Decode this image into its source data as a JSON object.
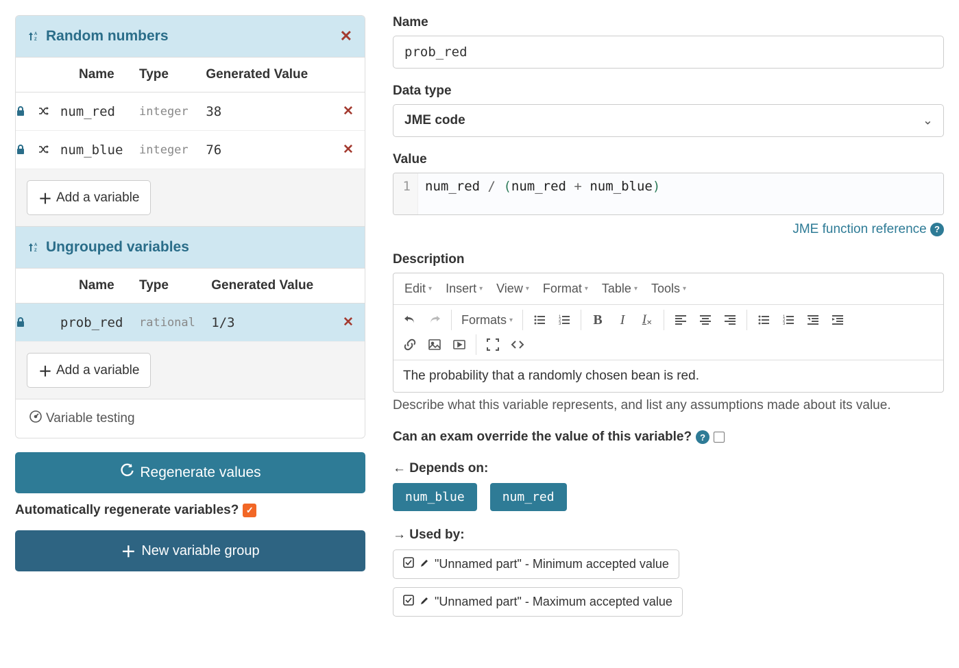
{
  "left": {
    "groups": [
      {
        "title": "Random numbers",
        "can_delete": true,
        "columns": {
          "name": "Name",
          "type": "Type",
          "value": "Generated Value"
        },
        "rows": [
          {
            "locked": true,
            "shuffle": true,
            "name": "num_red",
            "type": "integer",
            "value": "38",
            "selected": false
          },
          {
            "locked": true,
            "shuffle": true,
            "name": "num_blue",
            "type": "integer",
            "value": "76",
            "selected": false
          }
        ],
        "add_label": "Add a variable"
      },
      {
        "title": "Ungrouped variables",
        "can_delete": false,
        "columns": {
          "name": "Name",
          "type": "Type",
          "value": "Generated Value"
        },
        "rows": [
          {
            "locked": true,
            "shuffle": false,
            "name": "prob_red",
            "type": "rational",
            "value": "1/3",
            "selected": true
          }
        ],
        "add_label": "Add a variable"
      }
    ],
    "variable_testing": "Variable testing",
    "regenerate": "Regenerate values",
    "auto_regen_label": "Automatically regenerate variables?",
    "auto_regen_checked": true,
    "new_group": "New variable group"
  },
  "right": {
    "name_label": "Name",
    "name_value": "prob_red",
    "datatype_label": "Data type",
    "datatype_value": "JME code",
    "value_label": "Value",
    "value_line_no": "1",
    "value_tokens": [
      {
        "t": "num_red",
        "c": "ident"
      },
      {
        "t": " ",
        "c": ""
      },
      {
        "t": "/",
        "c": "op"
      },
      {
        "t": " ",
        "c": ""
      },
      {
        "t": "(",
        "c": "paren"
      },
      {
        "t": "num_red",
        "c": "ident"
      },
      {
        "t": " ",
        "c": ""
      },
      {
        "t": "+",
        "c": "op"
      },
      {
        "t": " ",
        "c": ""
      },
      {
        "t": "num_blue",
        "c": "ident"
      },
      {
        "t": ")",
        "c": "paren"
      }
    ],
    "jme_ref": "JME function reference",
    "description_label": "Description",
    "menubar": [
      "Edit",
      "Insert",
      "View",
      "Format",
      "Table",
      "Tools"
    ],
    "formats_label": "Formats",
    "description_text": "The probability that a randomly chosen bean is red.",
    "description_help": "Describe what this variable represents, and list any assumptions made about its value.",
    "override_label": "Can an exam override the value of this variable?",
    "override_checked": false,
    "depends_label": "← Depends on:",
    "depends": [
      "num_blue",
      "num_red"
    ],
    "usedby_label": "→ Used by:",
    "usedby": [
      "\"Unnamed part\" - Minimum accepted value",
      "\"Unnamed part\" - Maximum accepted value"
    ]
  }
}
